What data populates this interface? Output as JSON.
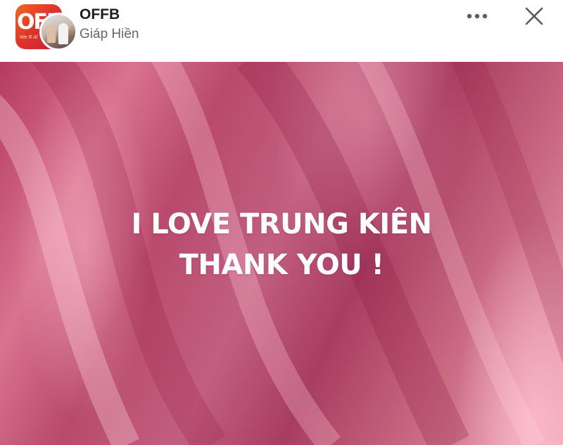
{
  "header": {
    "group_name": "OFFB",
    "author_name": "Giáp Hiền",
    "group_logo_text": "OFF",
    "group_logo_subtext": "We R Al",
    "more_icon": "more-horizontal-icon",
    "close_icon": "close-icon"
  },
  "post": {
    "line1": "I LOVE TRUNG KIÊN",
    "line2": "THANK YOU !",
    "background_color": "#c25f80",
    "text_color": "#ffffff"
  }
}
